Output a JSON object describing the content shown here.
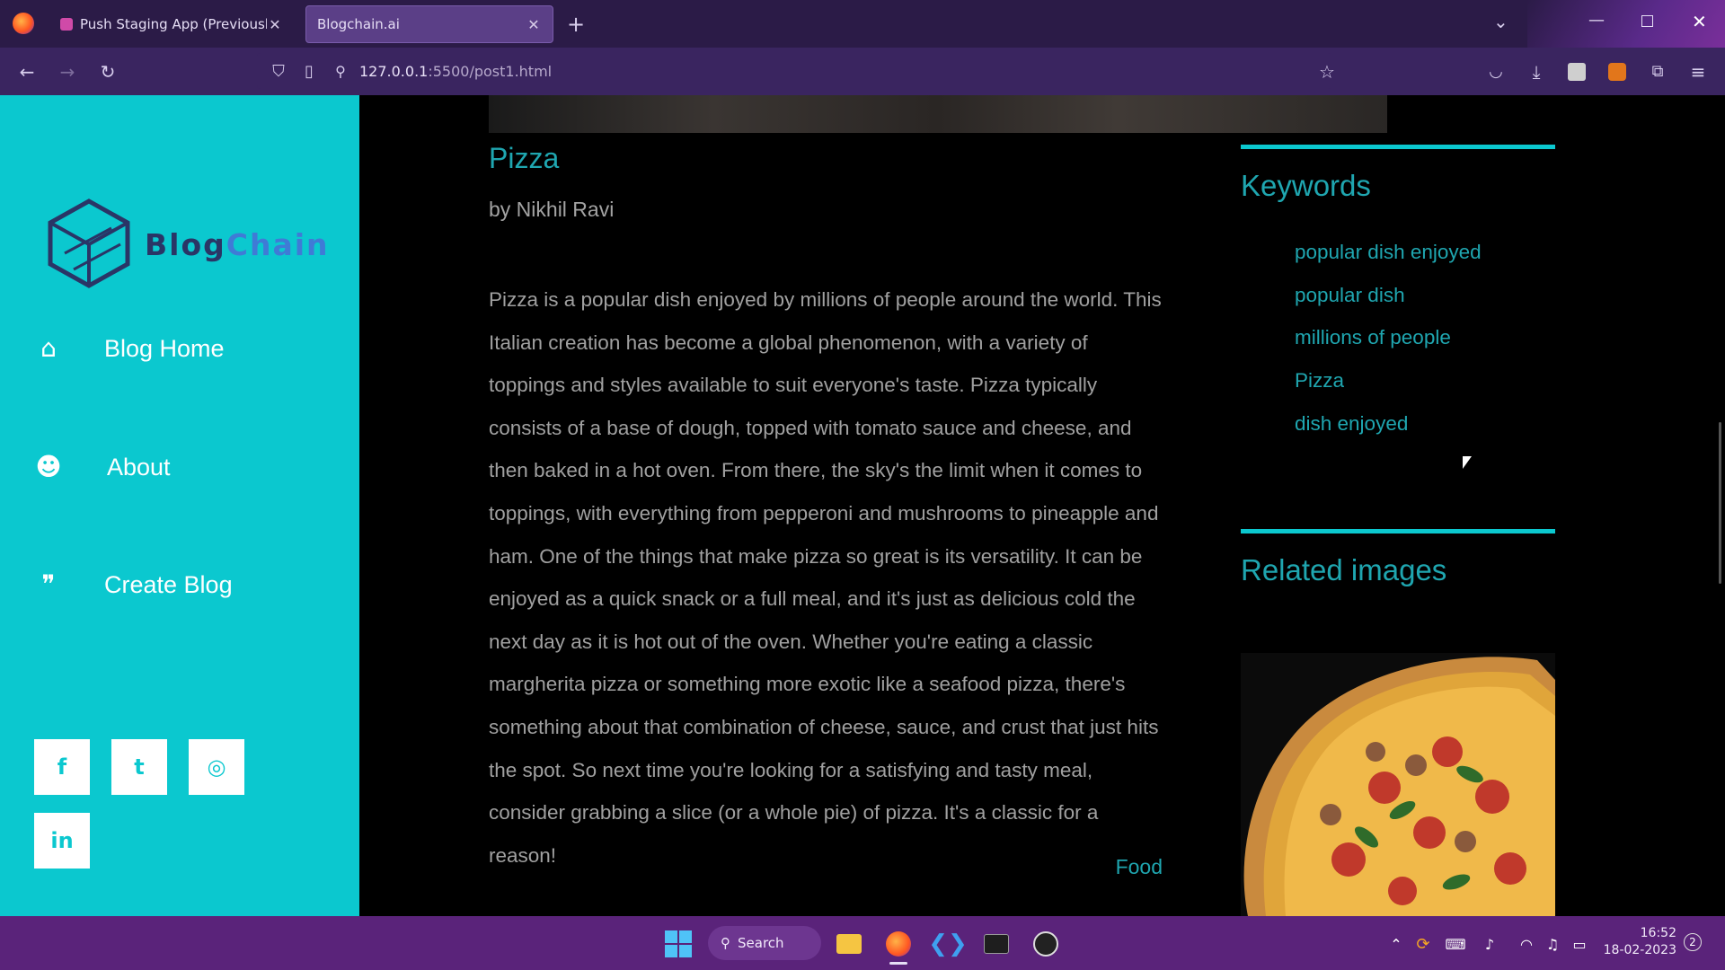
{
  "browser": {
    "tabs": [
      {
        "label": "Push Staging App (Previously E"
      },
      {
        "label": "Blogchain.ai"
      }
    ],
    "url_host": "127.0.0.1",
    "url_path": ":5500/post1.html"
  },
  "sidebar": {
    "logo_part1": "Blog",
    "logo_part2": "Chain",
    "nav": [
      {
        "label": "Blog Home",
        "icon": "home-icon"
      },
      {
        "label": "About",
        "icon": "users-icon"
      },
      {
        "label": "Create Blog",
        "icon": "comments-icon"
      }
    ],
    "social": [
      "facebook-icon",
      "twitter-icon",
      "instagram-icon",
      "linkedin-icon"
    ]
  },
  "post": {
    "title": "Pizza",
    "author": "by Nikhil Ravi",
    "body": "Pizza is a popular dish enjoyed by millions of people around the world. This Italian creation has become a global phenomenon, with a variety of toppings and styles available to suit everyone's taste. Pizza typically consists of a base of dough, topped with tomato sauce and cheese, and then baked in a hot oven. From there, the sky's the limit when it comes to toppings, with everything from pepperoni and mushrooms to pineapple and ham. One of the things that make pizza so great is its versatility. It can be enjoyed as a quick snack or a full meal, and it's just as delicious cold the next day as it is hot out of the oven. Whether you're eating a classic margherita pizza or something more exotic like a seafood pizza, there's something about that combination of cheese, sauce, and crust that just hits the spot. So next time you're looking for a satisfying and tasty meal, consider grabbing a slice (or a whole pie) of pizza. It's a classic for a reason!",
    "category": "Food"
  },
  "rail": {
    "keywords_heading": "Keywords",
    "keywords": [
      "popular dish enjoyed",
      "popular dish",
      "millions of people",
      "Pizza",
      "dish enjoyed"
    ],
    "images_heading": "Related images"
  },
  "taskbar": {
    "search_label": "Search",
    "time": "16:52",
    "date": "18-02-2023",
    "notifications": "2"
  },
  "colors": {
    "accent": "#0bc8cf",
    "link": "#1fa6b0",
    "taskbar": "#5a237a"
  }
}
